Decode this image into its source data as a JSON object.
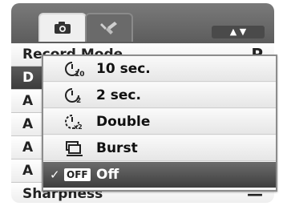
{
  "tabs": [
    {
      "name": "camera",
      "icon": "camera-icon",
      "active": true
    },
    {
      "name": "setup",
      "icon": "wrench-icon",
      "active": false
    }
  ],
  "scroll_arrows": "▲ ▼",
  "menu": {
    "rows": [
      {
        "label": "Record Mode",
        "value": "P"
      },
      {
        "label": "D",
        "value": ""
      },
      {
        "label": "A",
        "value": ""
      },
      {
        "label": "A",
        "value": ""
      },
      {
        "label": "A",
        "value": ""
      },
      {
        "label": "Sharpness",
        "value": "—"
      }
    ],
    "selected_index": 1
  },
  "popup": {
    "options": [
      {
        "label": "10 sec.",
        "icon": "self-timer-10-icon"
      },
      {
        "label": "2 sec.",
        "icon": "self-timer-2-icon"
      },
      {
        "label": "Double",
        "icon": "self-timer-double-icon"
      },
      {
        "label": "Burst",
        "icon": "burst-icon"
      },
      {
        "label": "Off",
        "icon": "off-icon",
        "badge": "OFF"
      }
    ],
    "selected_index": 4,
    "check_mark": "✓"
  },
  "colors": {
    "selected_bg": "#4a4a4a",
    "panel_bg": "#6a6a6a"
  }
}
